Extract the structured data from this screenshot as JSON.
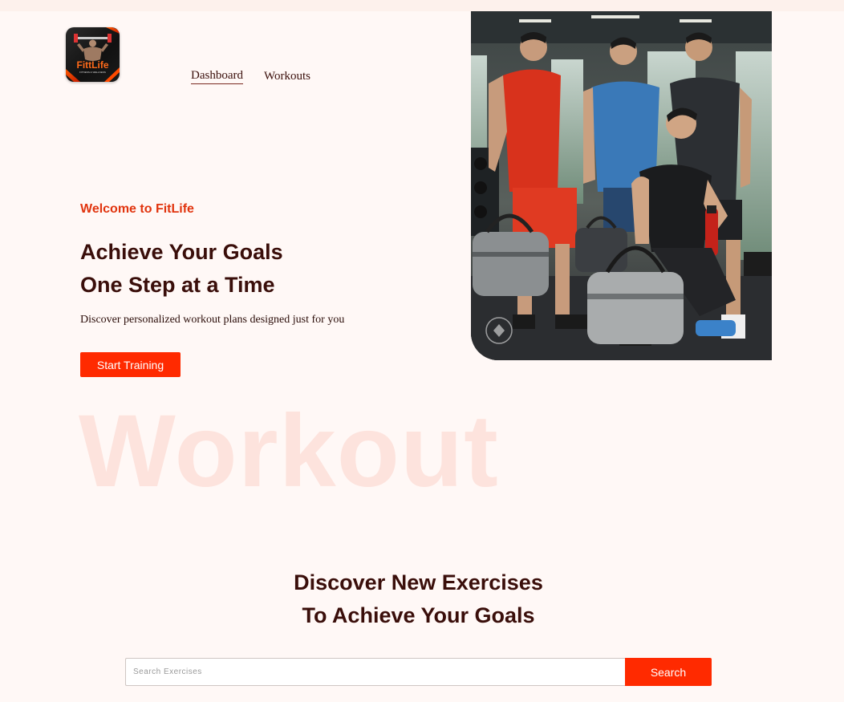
{
  "brand": {
    "logo_text": "FittLife",
    "logo_tagline": "FITNESS & WELLNESS",
    "accent": "#ff2a00",
    "text_color": "#3a0e0a",
    "background": "#fff8f6"
  },
  "nav": {
    "items": [
      {
        "label": "Dashboard",
        "active": true
      },
      {
        "label": "Workouts",
        "active": false
      }
    ]
  },
  "hero": {
    "eyebrow": "Welcome to FitLife",
    "headline_line1": "Achieve Your Goals",
    "headline_line2": "One Step at a Time",
    "subtitle": "Discover personalized workout plans designed just for you",
    "cta_label": "Start Training",
    "watermark": "Workout",
    "image_desc_icon": "gym-team-photo"
  },
  "exercises": {
    "title_line1": "Discover New Exercises",
    "title_line2": "To Achieve Your Goals",
    "search_placeholder": "Search Exercises",
    "search_value": "",
    "search_button": "Search"
  }
}
